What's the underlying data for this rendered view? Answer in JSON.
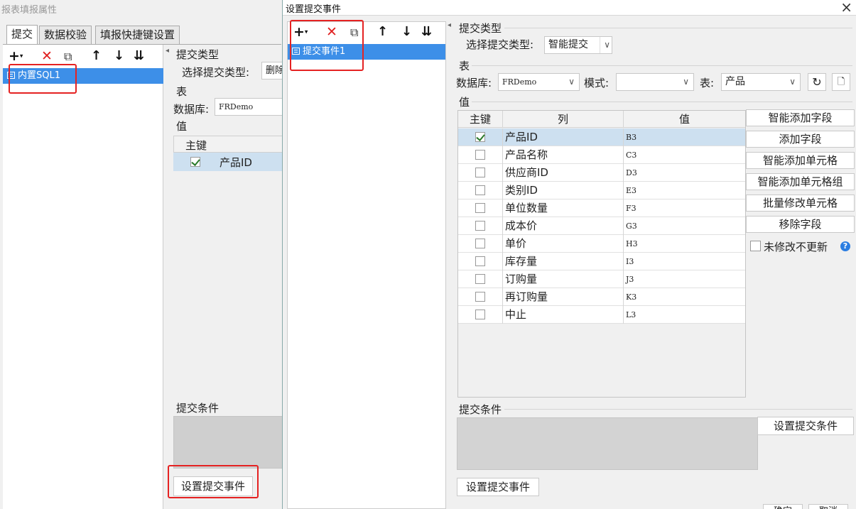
{
  "back": {
    "title": "报表填报属性",
    "tabs": [
      "提交",
      "数据校验",
      "填报快捷键设置"
    ],
    "list_item": "内置SQL1",
    "submit_type_section": "提交类型",
    "select_submit_type_label": "选择提交类型:",
    "submit_type_value": "删除",
    "table_section": "表",
    "db_label": "数据库:",
    "db_value": "FRDemo",
    "value_section": "值",
    "pk_header": "主键",
    "first_row_col": "产品ID",
    "condition_section": "提交条件",
    "set_event_button": "设置提交事件"
  },
  "front": {
    "title": "设置提交事件",
    "list_item": "提交事件1",
    "submit_type_section": "提交类型",
    "select_submit_type_label": "选择提交类型:",
    "submit_type_value": "智能提交",
    "table_section": "表",
    "db_label": "数据库:",
    "db_value": "FRDemo",
    "mode_label": "模式:",
    "mode_value": "",
    "table_label": "表:",
    "table_value": "产品",
    "value_section": "值",
    "headers": {
      "key": "主键",
      "col": "列",
      "val": "值"
    },
    "rows": [
      {
        "col": "产品ID",
        "val": "B3",
        "key": true
      },
      {
        "col": "产品名称",
        "val": "C3",
        "key": false
      },
      {
        "col": "供应商ID",
        "val": "D3",
        "key": false
      },
      {
        "col": "类别ID",
        "val": "E3",
        "key": false
      },
      {
        "col": "单位数量",
        "val": "F3",
        "key": false
      },
      {
        "col": "成本价",
        "val": "G3",
        "key": false
      },
      {
        "col": "单价",
        "val": "H3",
        "key": false
      },
      {
        "col": "库存量",
        "val": "I3",
        "key": false
      },
      {
        "col": "订购量",
        "val": "J3",
        "key": false
      },
      {
        "col": "再订购量",
        "val": "K3",
        "key": false
      },
      {
        "col": "中止",
        "val": "L3",
        "key": false
      }
    ],
    "side_buttons": {
      "smart_add_field": "智能添加字段",
      "add_field": "添加字段",
      "smart_add_cell": "智能添加单元格",
      "smart_add_cell_group": "智能添加单元格组",
      "batch_modify_cell": "批量修改单元格",
      "remove_field": "移除字段"
    },
    "no_update_unmodified": "未修改不更新",
    "condition_section": "提交条件",
    "set_condition_button": "设置提交条件",
    "set_event_button": "设置提交事件",
    "ok_button": "确定",
    "cancel_button": "取消"
  }
}
